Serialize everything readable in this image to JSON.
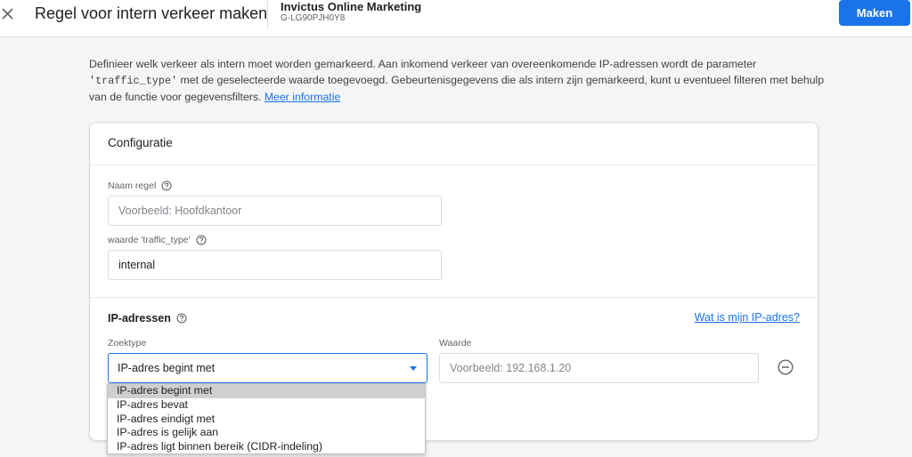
{
  "header": {
    "title": "Regel voor intern verkeer maken",
    "account_name": "Invictus Online Marketing",
    "property_id": "G-LG90PJH0Y8",
    "make_label": "Maken"
  },
  "description": {
    "part1": "Definieer welk verkeer als intern moet worden gemarkeerd. Aan inkomend verkeer van overeenkomende IP-adressen wordt de parameter ",
    "code": "'traffic_type'",
    "part2": " met de geselecteerde waarde toegevoegd. Gebeurtenisgegevens die als intern zijn gemarkeerd, kunt u eventueel filteren met behulp van de functie voor gegevensfilters. ",
    "link": "Meer informatie"
  },
  "config": {
    "title": "Configuratie",
    "rule_name_label": "Naam regel",
    "rule_name_placeholder": "Voorbeeld: Hoofdkantoor",
    "traffic_type_label": "waarde 'traffic_type'",
    "traffic_type_value": "internal"
  },
  "ip_section": {
    "title": "IP-adressen",
    "link": "Wat is mijn IP-adres?",
    "match_type_label": "Zoektype",
    "value_label": "Waarde",
    "selected_match_type": "IP-adres begint met",
    "value_placeholder": "Voorbeeld: 192.168.1.20"
  },
  "dropdown": {
    "options": [
      "IP-adres begint met",
      "IP-adres bevat",
      "IP-adres eindigt met",
      "IP-adres is gelijk aan",
      "IP-adres ligt binnen bereik (CIDR-indeling)"
    ],
    "selected_index": 0
  },
  "colors": {
    "accent": "#1a73e8",
    "background": "#f5f5f5"
  }
}
